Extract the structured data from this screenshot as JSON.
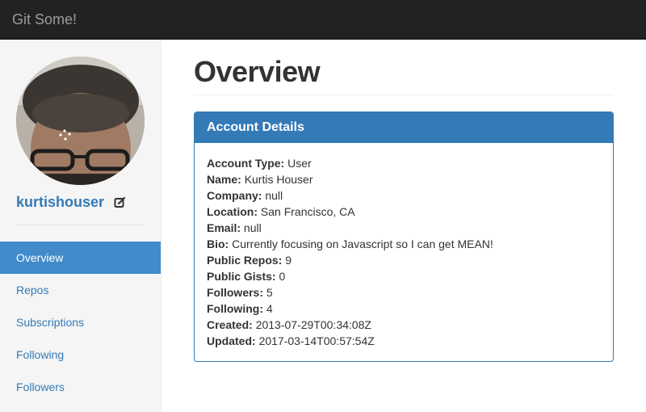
{
  "navbar": {
    "brand": "Git Some!"
  },
  "sidebar": {
    "username": "kurtishouser",
    "items": [
      {
        "label": "Overview",
        "active": true
      },
      {
        "label": "Repos",
        "active": false
      },
      {
        "label": "Subscriptions",
        "active": false
      },
      {
        "label": "Following",
        "active": false
      },
      {
        "label": "Followers",
        "active": false
      }
    ]
  },
  "main": {
    "title": "Overview",
    "panel": {
      "heading": "Account Details",
      "rows": [
        {
          "label": "Account Type:",
          "value": "User"
        },
        {
          "label": "Name:",
          "value": "Kurtis Houser"
        },
        {
          "label": "Company:",
          "value": "null"
        },
        {
          "label": "Location:",
          "value": "San Francisco, CA"
        },
        {
          "label": "Email:",
          "value": "null"
        },
        {
          "label": "Bio:",
          "value": "Currently focusing on Javascript so I can get MEAN!"
        },
        {
          "label": "Public Repos:",
          "value": "9"
        },
        {
          "label": "Public Gists:",
          "value": "0"
        },
        {
          "label": "Followers:",
          "value": "5"
        },
        {
          "label": "Following:",
          "value": "4"
        },
        {
          "label": "Created:",
          "value": "2013-07-29T00:34:08Z"
        },
        {
          "label": "Updated:",
          "value": "2017-03-14T00:57:54Z"
        }
      ]
    }
  },
  "colors": {
    "navbar_bg": "#222222",
    "brand_text": "#9d9d9d",
    "link": "#337ab7",
    "active_nav": "#428bca",
    "panel_primary": "#337ab7",
    "sidebar_bg": "#f5f5f5"
  },
  "icons": {
    "edit": "edit-icon",
    "avatar": "profile-photo"
  }
}
